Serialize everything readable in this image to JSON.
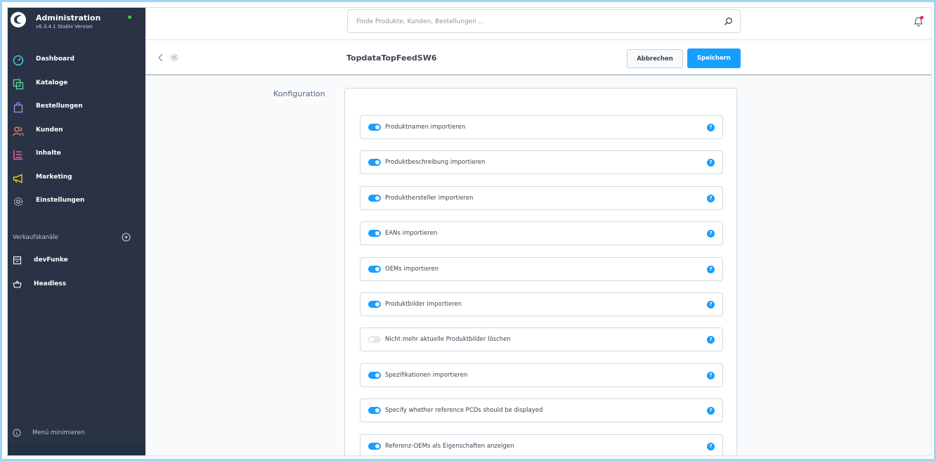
{
  "app": {
    "title": "Administration",
    "version": "v6.3.4.1 Stable Version"
  },
  "sidebar": {
    "items": [
      {
        "label": "Dashboard",
        "icon": "dashboard-icon",
        "color": "#57d9fd"
      },
      {
        "label": "Kataloge",
        "icon": "catalog-icon",
        "color": "#57d9a3"
      },
      {
        "label": "Bestellungen",
        "icon": "orders-icon",
        "color": "#a092f0"
      },
      {
        "label": "Kunden",
        "icon": "customers-icon",
        "color": "#f88962"
      },
      {
        "label": "Inhalte",
        "icon": "content-icon",
        "color": "#ff68b4"
      },
      {
        "label": "Marketing",
        "icon": "marketing-icon",
        "color": "#ffd700"
      },
      {
        "label": "Einstellungen",
        "icon": "settings-icon",
        "color": "#c9d0dc"
      }
    ],
    "sales_channels_title": "Verkaufskanäle",
    "sales_channels": [
      {
        "label": "devFunke",
        "icon": "storefront-icon"
      },
      {
        "label": "Headless",
        "icon": "basket-icon"
      }
    ],
    "minimize_label": "Menü minimieren"
  },
  "search": {
    "placeholder": "Finde Produkte, Kunden, Bestellungen ..."
  },
  "header": {
    "title": "TopdataTopFeedSW6",
    "cancel_label": "Abbrechen",
    "save_label": "Speichern"
  },
  "config": {
    "section_label": "Konfiguration",
    "rows": [
      {
        "label": "Produktnamen importieren",
        "enabled": true
      },
      {
        "label": "Produktbeschreibung importieren",
        "enabled": true
      },
      {
        "label": "Produkthersteller importieren",
        "enabled": true
      },
      {
        "label": "EANs importieren",
        "enabled": true
      },
      {
        "label": "OEMs importieren",
        "enabled": true
      },
      {
        "label": "Produktbilder importieren",
        "enabled": true
      },
      {
        "label": "Nicht mehr aktuelle Produktbilder löschen",
        "enabled": false
      },
      {
        "label": "Spezifikationen importieren",
        "enabled": true
      },
      {
        "label": "Specify whether reference PCDs should be displayed",
        "enabled": true
      },
      {
        "label": "Referenz-OEMs als Eigenschaften anzeigen",
        "enabled": true
      }
    ]
  },
  "colors": {
    "accent": "#189eff",
    "sidebar_bg": "#2a3345",
    "status_online": "#37d046",
    "notification": "#de294c"
  }
}
